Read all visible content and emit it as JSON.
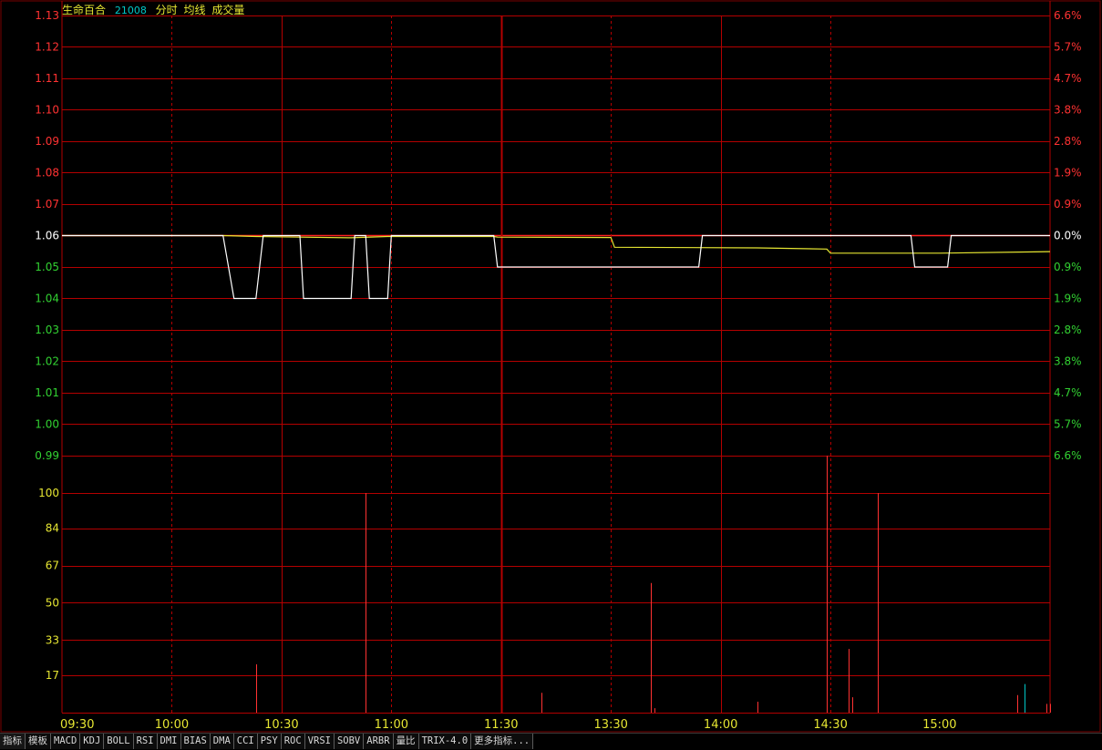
{
  "header": {
    "name": "生命百合",
    "code": "21008",
    "mode": "分时",
    "avg_label": "均线",
    "vol_label": "成交量"
  },
  "colors": {
    "grid": "#b40000",
    "axis_up": "#ff3232",
    "axis_down": "#32d232",
    "axis_neutral": "#ffffff",
    "price_line": "#ffffff",
    "avg_line": "#e6e632",
    "vol_label": "#e6e632",
    "time_label": "#e6e632",
    "vol_bar_up": "#ff3232",
    "vol_bar_flat": "#00c8c8"
  },
  "chart_data": [
    {
      "type": "line",
      "x_ticks": [
        "09:30",
        "10:00",
        "10:30",
        "11:00",
        "11:30",
        "13:30",
        "14:00",
        "14:30",
        "15:00"
      ],
      "ylim": [
        0.99,
        1.13
      ],
      "y_ticks": [
        "1.13",
        "1.12",
        "1.11",
        "1.10",
        "1.09",
        "1.08",
        "1.07",
        "1.06",
        "1.05",
        "1.04",
        "1.03",
        "1.02",
        "1.01",
        "1.00",
        "0.99"
      ],
      "pct_ticks": [
        "6.6%",
        "5.7%",
        "4.7%",
        "3.8%",
        "2.8%",
        "1.9%",
        "0.9%",
        "0.0%",
        "0.9%",
        "1.9%",
        "2.8%",
        "3.8%",
        "4.7%",
        "5.7%",
        "6.6%"
      ],
      "prev_close": 1.06,
      "series": [
        {
          "role": "price",
          "x": [
            0,
            44,
            47,
            53,
            55,
            65,
            66,
            79,
            80,
            83,
            84,
            89,
            90,
            118,
            119,
            174,
            175,
            232,
            233,
            242,
            243,
            270
          ],
          "values": [
            1.06,
            1.06,
            1.04,
            1.04,
            1.06,
            1.06,
            1.04,
            1.04,
            1.06,
            1.06,
            1.04,
            1.04,
            1.06,
            1.06,
            1.05,
            1.05,
            1.06,
            1.06,
            1.05,
            1.05,
            1.06,
            1.06
          ]
        },
        {
          "role": "average",
          "x": [
            0,
            44,
            53,
            65,
            79,
            89,
            118,
            119,
            150,
            151,
            190,
            209,
            210,
            240,
            270
          ],
          "values": [
            1.06,
            1.06,
            1.0597,
            1.0595,
            1.0593,
            1.0597,
            1.0597,
            1.0595,
            1.0594,
            1.0563,
            1.0561,
            1.0557,
            1.0544,
            1.0544,
            1.0549
          ]
        }
      ]
    },
    {
      "type": "bar",
      "ylim": [
        0,
        117
      ],
      "y_ticks": [
        "100",
        "84",
        "67",
        "50",
        "33",
        "17"
      ],
      "x": [
        53,
        83,
        131,
        161,
        162,
        190,
        209,
        215,
        216,
        223,
        261,
        263,
        269,
        270
      ],
      "values": [
        22,
        100,
        9,
        59,
        2,
        5,
        117,
        29,
        7,
        100,
        8,
        13,
        4,
        4
      ],
      "flat_x": [
        263
      ]
    }
  ],
  "toolbar": {
    "tabs": [
      "指标",
      "模板",
      "MACD",
      "KDJ",
      "BOLL",
      "RSI",
      "DMI",
      "BIAS",
      "DMA",
      "CCI",
      "PSY",
      "ROC",
      "VRSI",
      "SOBV",
      "ARBR",
      "量比",
      "TRIX-4.0",
      "更多指标..."
    ]
  }
}
